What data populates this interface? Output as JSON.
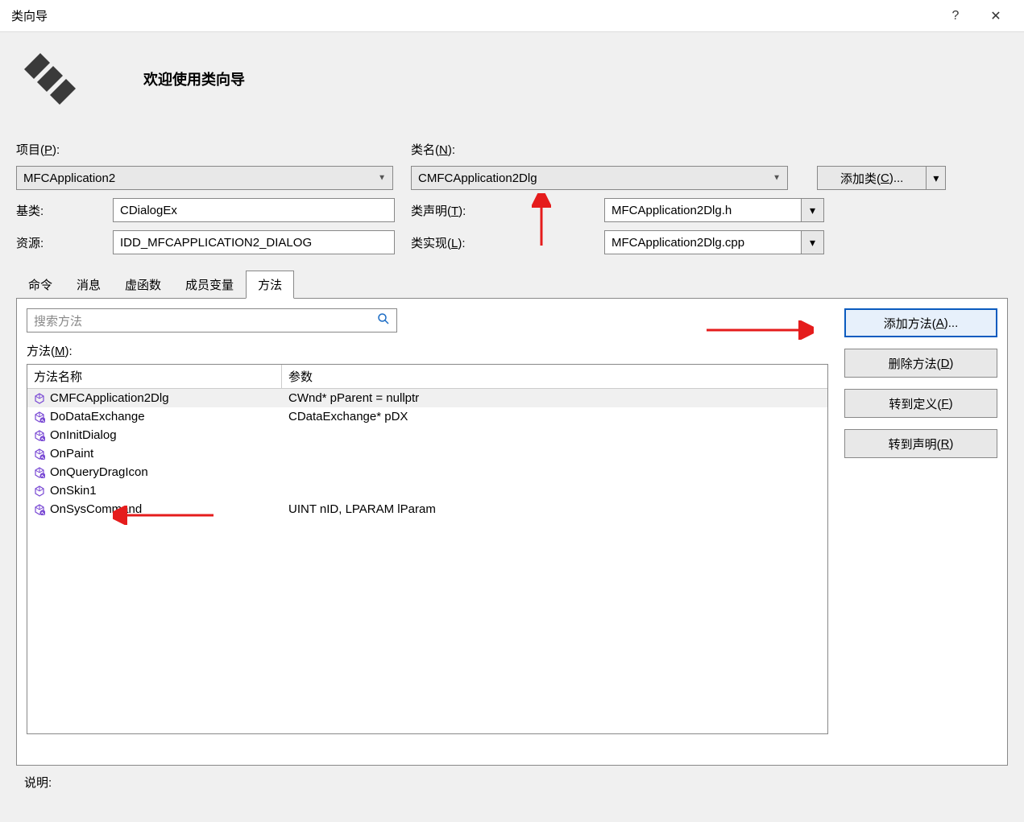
{
  "title": "类向导",
  "welcome": "欢迎使用类向导",
  "labels": {
    "project": "项目(P):",
    "class_name": "类名(N):",
    "base_class": "基类:",
    "class_decl": "类声明(T):",
    "resource": "资源:",
    "class_impl": "类实现(L):",
    "add_class": "添加类(C)...",
    "methods": "方法(M):",
    "desc": "说明:"
  },
  "project_value": "MFCApplication2",
  "class_value": "CMFCApplication2Dlg",
  "base_value": "CDialogEx",
  "decl_file": "MFCApplication2Dlg.h",
  "resource_value": "IDD_MFCAPPLICATION2_DIALOG",
  "impl_file": "MFCApplication2Dlg.cpp",
  "tabs": [
    "命令",
    "消息",
    "虚函数",
    "成员变量",
    "方法"
  ],
  "active_tab": 4,
  "search_placeholder": "搜索方法",
  "table_headers": {
    "name": "方法名称",
    "params": "参数"
  },
  "methods_list": [
    {
      "name": "CMFCApplication2Dlg",
      "params": "CWnd* pParent = nullptr",
      "override": false,
      "selected": true
    },
    {
      "name": "DoDataExchange",
      "params": "CDataExchange* pDX",
      "override": true
    },
    {
      "name": "OnInitDialog",
      "params": "",
      "override": true
    },
    {
      "name": "OnPaint",
      "params": "",
      "override": true
    },
    {
      "name": "OnQueryDragIcon",
      "params": "",
      "override": true
    },
    {
      "name": "OnSkin1",
      "params": "",
      "override": false
    },
    {
      "name": "OnSysCommand",
      "params": "UINT nID, LPARAM lParam",
      "override": true
    }
  ],
  "side_buttons": {
    "add_method": "添加方法(A)...",
    "delete_method": "删除方法(D)",
    "goto_def": "转到定义(F)",
    "goto_decl": "转到声明(R)"
  }
}
